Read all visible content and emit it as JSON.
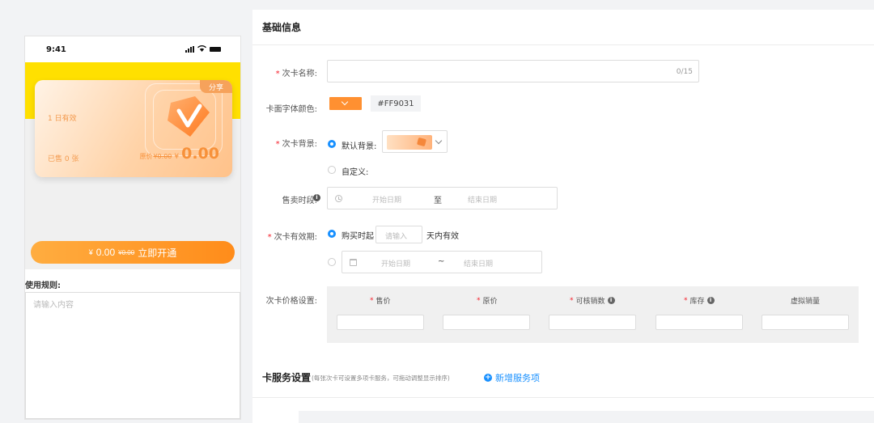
{
  "phone": {
    "time": "9:41",
    "card": {
      "share": "分享",
      "valid": "1 日有效",
      "sold": "已售 0 张",
      "orig_label": "原价",
      "orig_price": "¥0.00",
      "currency": "¥",
      "price": "0.00",
      "color": "#ff9031"
    },
    "buy": {
      "currency": "¥",
      "price": "0.00",
      "orig": "¥0.00",
      "label": "立即开通"
    },
    "rules": {
      "label": "使用规则:",
      "placeholder": "请输入内容"
    }
  },
  "form": {
    "section_title": "基础信息",
    "name": {
      "label": "次卡名称:",
      "value": "",
      "counter": "0/15"
    },
    "font_color": {
      "label": "卡面字体颜色:",
      "value": "#FF9031"
    },
    "background": {
      "label": "次卡背景:",
      "default": "默认背景:",
      "custom": "自定义:"
    },
    "sale_period": {
      "label": "售卖时段:",
      "start": "开始日期",
      "to": "至",
      "end": "结束日期"
    },
    "validity": {
      "label": "次卡有效期:",
      "option1_prefix": "购买时起",
      "days_placeholder": "请输入",
      "option1_suffix": "天内有效",
      "start": "开始日期",
      "to": "~",
      "end": "结束日期"
    },
    "price_settings": {
      "label": "次卡价格设置:",
      "columns": [
        {
          "name": "售价",
          "required": true,
          "info": false
        },
        {
          "name": "原价",
          "required": true,
          "info": false
        },
        {
          "name": "可核销数",
          "required": true,
          "info": true
        },
        {
          "name": "库存",
          "required": true,
          "info": true
        },
        {
          "name": "虚拟销量",
          "required": false,
          "info": false
        }
      ]
    }
  },
  "services": {
    "title": "卡服务设置",
    "note": "(每张次卡可设置多项卡服务，可拖动调整显示排序)",
    "add_label": "新增服务项"
  },
  "colors": {
    "accent": "#1890ff",
    "brand_orange": "#ff9031",
    "banner_yellow": "#ffe000",
    "required": "#f5222d"
  }
}
